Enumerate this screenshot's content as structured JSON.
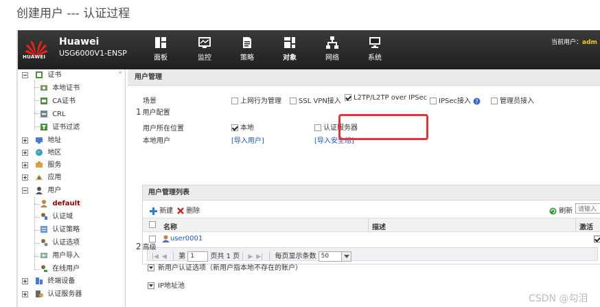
{
  "page_title": "创建用户 --- 认证过程",
  "header": {
    "brand": "Huawei",
    "logo_text": "HUAWEI",
    "device": "USG6000V1-ENSP",
    "nav": [
      {
        "label": "面板",
        "icon": "dashboard-icon"
      },
      {
        "label": "监控",
        "icon": "monitor-icon"
      },
      {
        "label": "策略",
        "icon": "policy-icon"
      },
      {
        "label": "对象",
        "icon": "object-icon",
        "active": true
      },
      {
        "label": "网络",
        "icon": "network-icon"
      },
      {
        "label": "系统",
        "icon": "system-icon"
      }
    ],
    "current_user_label": "当前用户：",
    "current_user": "adm"
  },
  "sidebar": {
    "collapse": "«",
    "items": [
      {
        "label": "证书",
        "icon": "certificate-icon"
      },
      {
        "label": "本地证书",
        "icon": "local-cert-icon"
      },
      {
        "label": "CA证书",
        "icon": "ca-cert-icon"
      },
      {
        "label": "CRL",
        "icon": "crl-icon"
      },
      {
        "label": "证书过滤",
        "icon": "cert-filter-icon"
      },
      {
        "label": "地址",
        "icon": "address-icon"
      },
      {
        "label": "地区",
        "icon": "region-icon"
      },
      {
        "label": "服务",
        "icon": "service-icon"
      },
      {
        "label": "应用",
        "icon": "application-icon"
      },
      {
        "label": "用户",
        "icon": "user-icon"
      },
      {
        "label": "default",
        "icon": "default-user-icon"
      },
      {
        "label": "认证域",
        "icon": "auth-domain-icon"
      },
      {
        "label": "认证策略",
        "icon": "auth-policy-icon"
      },
      {
        "label": "认证选项",
        "icon": "auth-option-icon"
      },
      {
        "label": "用户导入",
        "icon": "user-import-icon"
      },
      {
        "label": "在线用户",
        "icon": "online-user-icon"
      },
      {
        "label": "终端设备",
        "icon": "terminal-device-icon"
      },
      {
        "label": "认证服务器",
        "icon": "auth-server-icon"
      }
    ]
  },
  "content": {
    "panel_title": "用户管理",
    "scene_label": "场景",
    "scenes": [
      {
        "label": "上网行为管理",
        "checked": false
      },
      {
        "label": "SSL VPN接入",
        "checked": false
      },
      {
        "label": "L2TP/L2TP over IPSec",
        "checked": true
      },
      {
        "label": "IPSec接入",
        "checked": false
      },
      {
        "label": "管理员接入",
        "checked": false
      }
    ],
    "section1_num": "1",
    "section1_title": "用户配置",
    "user_location_label": "用户所在位置",
    "location_local": "本地",
    "location_auth_server": "认证服务器",
    "local_user_label": "本地用户",
    "import_user_link": "[导入用户]",
    "import_secgroup_link": "[导入安全组]",
    "list": {
      "title": "用户管理列表",
      "new_label": "新建",
      "delete_label": "删除",
      "refresh_label": "刷新",
      "search_placeholder": "请输入",
      "columns": [
        "名称",
        "描述",
        "激活"
      ],
      "rows": [
        {
          "name": "user0001",
          "description": "",
          "active": true
        }
      ],
      "pager": {
        "page_prefix": "第",
        "page_value": "1",
        "page_suffix": "页共 1 页",
        "per_page_label": "每页显示条数",
        "per_page_value": "50"
      }
    },
    "section2_num": "2",
    "section2_title": "高级",
    "advanced_items": [
      "新用户认证选项（新用户指本地不存在的账户）",
      "IP地址池"
    ]
  },
  "watermark": "CSDN @勾泪",
  "colors": {
    "highlight": "#e8303a",
    "link": "#1a56b8",
    "selected": "#8b0000"
  }
}
